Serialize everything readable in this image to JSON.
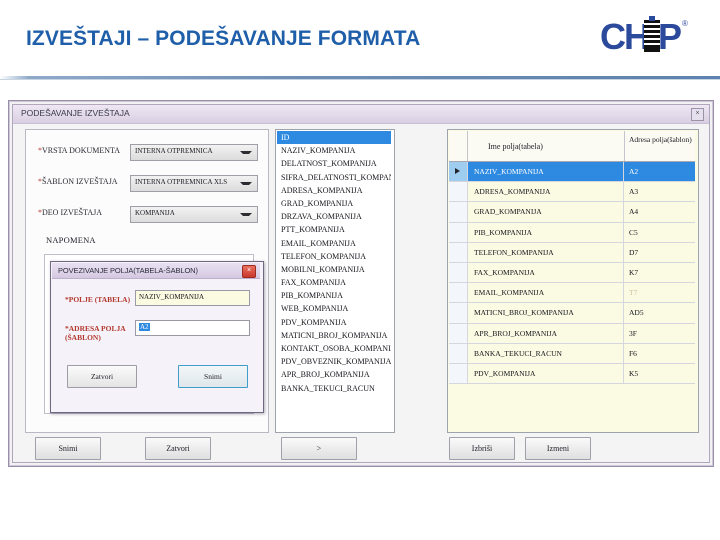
{
  "slide": {
    "title": "IZVEŠTAJI – PODEŠAVANJE FORMATA",
    "brand": "CHIP",
    "brand_mark": "®",
    "accent_color": "#1F5FA9"
  },
  "app_window": {
    "title": "PODEŠAVANJE IZVEŠTAJA",
    "close_label": "×"
  },
  "form": {
    "fields": [
      {
        "label": "VRSTA DOKUMENTA",
        "required": "*",
        "value": "INTERNA OTPREMNICA"
      },
      {
        "label": "ŠABLON IZVEŠTAJA",
        "required": "*",
        "value": "INTERNA OTPREMNICA XLS"
      },
      {
        "label": "DEO IZVEŠTAJA",
        "required": "*",
        "value": "KOMPANIJA"
      }
    ],
    "napomena_label": "NAPOMENA"
  },
  "field_list": {
    "items": [
      "ID",
      "NAZIV_KOMPANIJA",
      "DELATNOST_KOMPANIJA",
      "SIFRA_DELATNOSTI_KOMPANIJA",
      "ADRESA_KOMPANIJA",
      "GRAD_KOMPANIJA",
      "DRZAVA_KOMPANIJA",
      "PTT_KOMPANIJA",
      "EMAIL_KOMPANIJA",
      "TELEFON_KOMPANIJA",
      "MOBILNI_KOMPANIJA",
      "FAX_KOMPANIJA",
      "PIB_KOMPANIJA",
      "WEB_KOMPANIJA",
      "PDV_KOMPANIJA",
      "MATICNI_BROJ_KOMPANIJA",
      "KONTAKT_OSOBA_KOMPANIJA",
      "PDV_OBVEZNIK_KOMPANIJA",
      "APR_BROJ_KOMPANIJA",
      "BANKA_TEKUCI_RACUN"
    ],
    "selected_index": 0
  },
  "mapping_table": {
    "columns": [
      "Ime polja(tabela)",
      "Adresa polja(šablon)"
    ],
    "rows": [
      {
        "name": "NAZIV_KOMPANIJA",
        "address": "A2",
        "selected": true
      },
      {
        "name": "ADRESA_KOMPANIJA",
        "address": "A3",
        "selected": false
      },
      {
        "name": "GRAD_KOMPANIJA",
        "address": "A4",
        "selected": false
      },
      {
        "name": "PIB_KOMPANIJA",
        "address": "C5",
        "selected": false
      },
      {
        "name": "TELEFON_KOMPANIJA",
        "address": "D7",
        "selected": false
      },
      {
        "name": "FAX_KOMPANIJA",
        "address": "K7",
        "selected": false
      },
      {
        "name": "EMAIL_KOMPANIJA",
        "address": "T7",
        "selected": false,
        "faded": true
      },
      {
        "name": "MATICNI_BROJ_KOMPANIJA",
        "address": "AD5",
        "selected": false
      },
      {
        "name": "APR_BROJ_KOMPANIJA",
        "address": "3F",
        "selected": false
      },
      {
        "name": "BANKA_TEKUCI_RACUN",
        "address": "F6",
        "selected": false
      },
      {
        "name": "PDV_KOMPANIJA",
        "address": "K5",
        "selected": false
      }
    ]
  },
  "modal": {
    "title": "POVEZIVANJE POLJA(TABELA-ŠABLON)",
    "close_label": "×",
    "field_label": "*POLJE (TABELA)",
    "field_value": "NAZIV_KOMPANIJA",
    "address_label_line1": "*ADRESA POLJA",
    "address_label_line2": "(ŠABLON)",
    "address_value": "A2",
    "cancel_label": "Zatvori",
    "save_label": "Snimi"
  },
  "bottom_bar": {
    "save_label": "Snimi",
    "close_label": "Zatvori",
    "next_label": ">",
    "delete_label": "Izbriši",
    "edit_label": "Izmeni"
  }
}
